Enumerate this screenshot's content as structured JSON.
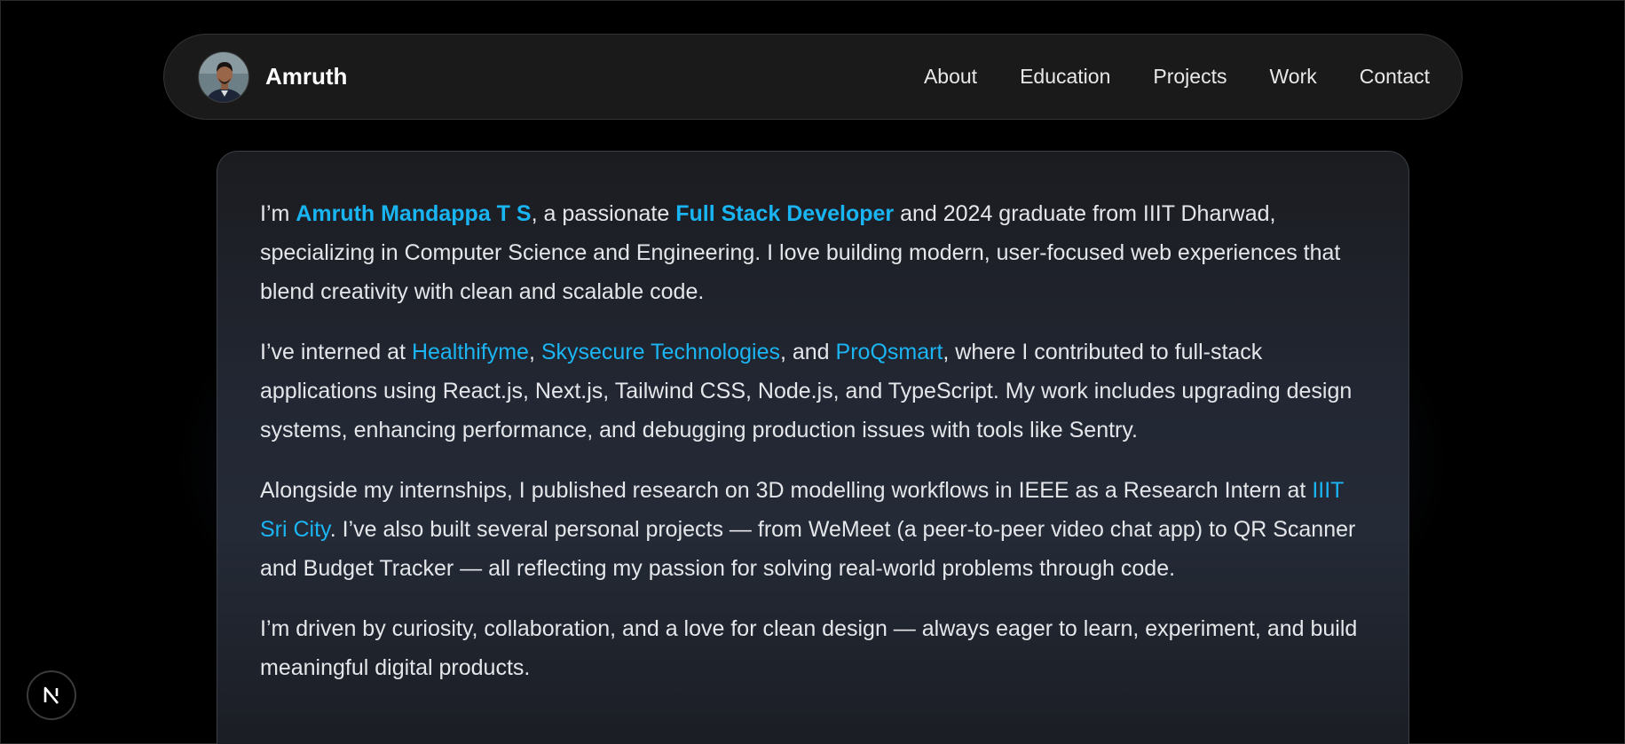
{
  "navbar": {
    "brand_name": "Amruth",
    "links": [
      "About",
      "Education",
      "Projects",
      "Work",
      "Contact"
    ]
  },
  "about": {
    "p1": {
      "t1": "I’m ",
      "name": "Amruth Mandappa T S",
      "t2": ", a passionate ",
      "role": "Full Stack Developer",
      "t3": " and 2024 graduate from IIIT Dharwad, specializing in Computer Science and Engineering. I love building modern, user-focused web experiences that blend creativity with clean and scalable code."
    },
    "p2": {
      "t1": "I’ve interned at ",
      "company1": "Healthifyme",
      "t2": ", ",
      "company2": "Skysecure Technologies",
      "t3": ", and ",
      "company3": "ProQsmart",
      "t4": ", where I contributed to full-stack applications using React.js, Next.js, Tailwind CSS, Node.js, and TypeScript. My work includes upgrading design systems, enhancing performance, and debugging production issues with tools like Sentry."
    },
    "p3": {
      "t1": "Alongside my internships, I published research on 3D modelling workflows in IEEE as a Research Intern at ",
      "institute": "IIIT Sri City",
      "t2": ". I’ve also built several personal projects — from WeMeet (a peer-to-peer video chat app) to QR Scanner and Budget Tracker — all reflecting my passion for solving real-world problems through code."
    },
    "p4": "I’m driven by curiosity, collaboration, and a love for clean design — always eager to learn, experiment, and build meaningful digital products."
  },
  "colors": {
    "accent": "#19b4f2",
    "background": "#000000",
    "navbar_bg": "#1a1a1a"
  },
  "icons": {
    "avatar": "profile-avatar",
    "badge": "nextjs-logo-icon"
  }
}
